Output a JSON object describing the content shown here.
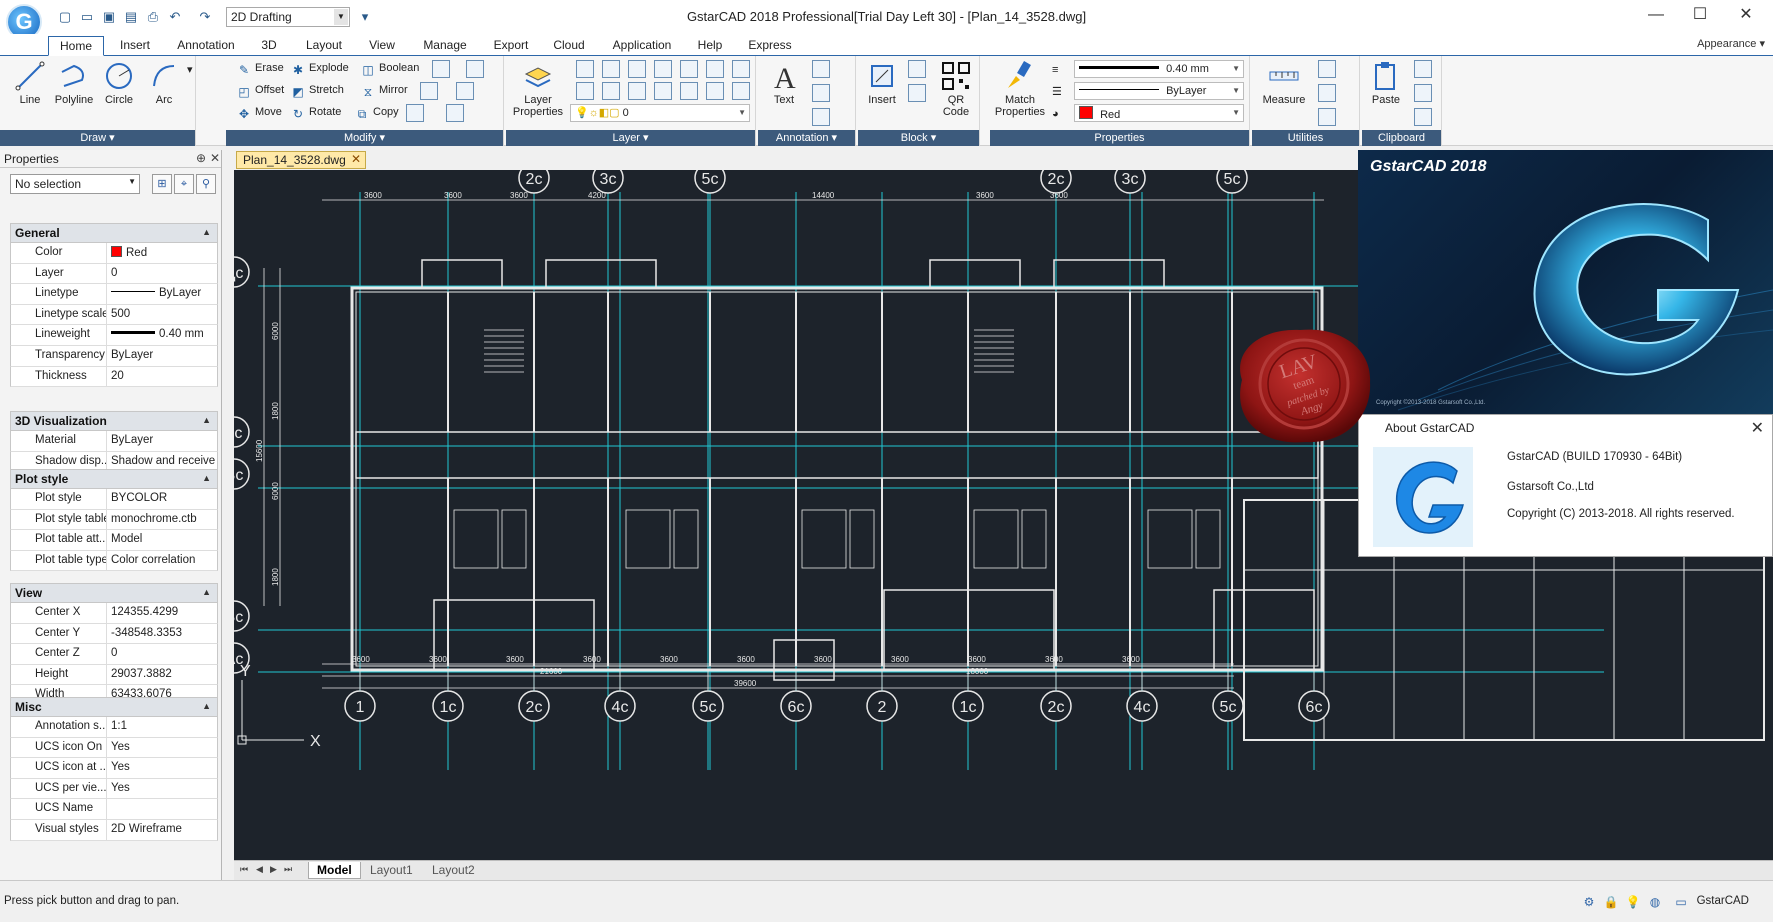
{
  "title_bar": {
    "window_title": "GstarCAD 2018 Professional[Trial Day Left 30] - [Plan_14_3528.dwg]",
    "workspace": "2D Drafting",
    "app_logo": "G",
    "quick_access": [
      "new-icon",
      "open-icon",
      "save-icon",
      "save-as-icon",
      "print-icon",
      "undo-icon",
      "redo-icon"
    ],
    "minimize_glyph": "—",
    "maximize_glyph": "☐",
    "close_glyph": "✕",
    "customize_glyph": "▾"
  },
  "ribbon": {
    "tabs": [
      "Home",
      "Insert",
      "Annotation",
      "3D",
      "Layout",
      "View",
      "Manage",
      "Export",
      "Cloud",
      "Application",
      "Help",
      "Express"
    ],
    "active_tab": "Home",
    "appearance": "Appearance ▾",
    "panels": {
      "draw": {
        "title": "Draw ▾",
        "tools": [
          "Line",
          "Polyline",
          "Circle",
          "Arc"
        ]
      },
      "modify": {
        "title": "Modify ▾",
        "tools": [
          "Erase",
          "Explode",
          "Boolean",
          "Offset",
          "Stretch",
          "Mirror",
          "Move",
          "Rotate",
          "Copy"
        ]
      },
      "layer": {
        "title": "Layer ▾",
        "tool": "Layer Properties",
        "current_layer": "0"
      },
      "annotation": {
        "title": "Annotation ▾",
        "tool": "Text"
      },
      "block": {
        "title": "Block ▾",
        "tools": [
          "Insert",
          "QR Code"
        ]
      },
      "properties": {
        "title": "Properties",
        "tool": "Match Properties",
        "lineweight": "0.40 mm",
        "linetype": "ByLayer",
        "color": "Red"
      },
      "utilities": {
        "title": "Utilities",
        "tool": "Measure"
      },
      "clipboard": {
        "title": "Clipboard",
        "tool": "Paste"
      }
    }
  },
  "properties_palette": {
    "title": "Properties",
    "selection": "No selection",
    "sections": [
      {
        "name": "General",
        "rows": [
          {
            "key": "Color",
            "value": "Red"
          },
          {
            "key": "Layer",
            "value": "0"
          },
          {
            "key": "Linetype",
            "value": "ByLayer"
          },
          {
            "key": "Linetype scale",
            "value": "500"
          },
          {
            "key": "Lineweight",
            "value": "0.40 mm"
          },
          {
            "key": "Transparency",
            "value": "ByLayer"
          },
          {
            "key": "Thickness",
            "value": "20"
          }
        ]
      },
      {
        "name": "3D Visualization",
        "rows": [
          {
            "key": "Material",
            "value": "ByLayer"
          },
          {
            "key": "Shadow disp...",
            "value": "Shadow and receive ..."
          }
        ]
      },
      {
        "name": "Plot style",
        "rows": [
          {
            "key": "Plot style",
            "value": "BYCOLOR"
          },
          {
            "key": "Plot style table",
            "value": "monochrome.ctb"
          },
          {
            "key": "Plot table att...",
            "value": "Model"
          },
          {
            "key": "Plot table type",
            "value": "Color correlation"
          }
        ]
      },
      {
        "name": "View",
        "rows": [
          {
            "key": "Center X",
            "value": "124355.4299"
          },
          {
            "key": "Center Y",
            "value": "-348548.3353"
          },
          {
            "key": "Center Z",
            "value": "0"
          },
          {
            "key": "Height",
            "value": "29037.3882"
          },
          {
            "key": "Width",
            "value": "63433.6076"
          }
        ]
      },
      {
        "name": "Misc",
        "rows": [
          {
            "key": "Annotation s...",
            "value": "1:1"
          },
          {
            "key": "UCS icon On",
            "value": "Yes"
          },
          {
            "key": "UCS icon at ...",
            "value": "Yes"
          },
          {
            "key": "UCS per vie...",
            "value": "Yes"
          },
          {
            "key": "UCS Name",
            "value": ""
          },
          {
            "key": "Visual styles",
            "value": "2D Wireframe"
          }
        ]
      }
    ]
  },
  "document": {
    "tab_name": "Plan_14_3528.dwg",
    "layout_tabs": [
      "Model",
      "Layout1",
      "Layout2"
    ],
    "active_layout": "Model",
    "axis_labels_top": [
      "2с",
      "3с",
      "5с",
      "2с",
      "3с",
      "5с"
    ],
    "axis_labels_bottom": [
      "1",
      "1с",
      "2с",
      "4с",
      "5с",
      "6с",
      "2",
      "1с",
      "2с",
      "4с",
      "5с",
      "6с"
    ],
    "axis_labels_left": [
      "Дс",
      "Гс",
      "Вс",
      "Бс",
      "Ас"
    ],
    "top_dims": [
      "3600",
      "3600",
      "3600",
      "4200",
      "14400",
      "3600",
      "3600"
    ],
    "bottom_dims": [
      "3600",
      "3600",
      "3600",
      "3600",
      "3600",
      "3600",
      "3600",
      "3600",
      "3600",
      "3600",
      "3600"
    ],
    "bottom_totals": [
      "21600",
      "18000",
      "39600"
    ],
    "left_dims": [
      "6000",
      "1800",
      "15600",
      "6000",
      "1800"
    ],
    "ucs_y": "Y",
    "ucs_x": "X"
  },
  "splash": {
    "title": "GstarCAD 2018",
    "copyright": "Copyright ©2013-2018 Gstarsoft Co.,Ltd."
  },
  "about_dialog": {
    "title": "About GstarCAD",
    "close": "✕",
    "build": "GstarCAD (BUILD 170930 - 64Bit)",
    "company": "Gstarsoft Co.,Ltd",
    "copyright": "Copyright (C) 2013-2018. All rights reserved."
  },
  "seal": {
    "line1": "LAV",
    "line2": "team",
    "line3": "patched by",
    "line4": "Angy"
  },
  "status_bar": {
    "prompt": "Press pick button and drag to pan.",
    "brand": "GstarCAD"
  },
  "colors": {
    "canvas_bg": "#1d232b",
    "wall": "#e8e8e8",
    "grid_axis": "#21c7d3",
    "panel_title_bg": "#3c5a7c",
    "accent": "#2c66a8"
  }
}
